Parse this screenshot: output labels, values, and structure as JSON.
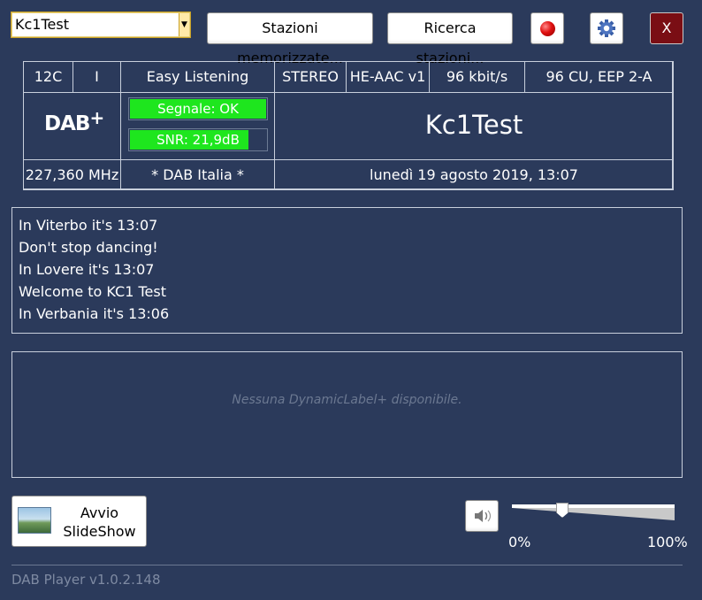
{
  "toolbar": {
    "station_selected": "Kc1Test",
    "saved_stations_label": "Stazioni memorizzate...",
    "search_stations_label": "Ricerca stazioni...",
    "close_label": "X",
    "record_icon": "record-icon",
    "settings_icon": "gear-icon"
  },
  "info": {
    "channel": "12C",
    "language": "I",
    "genre": "Easy Listening",
    "audio_mode": "STEREO",
    "codec": "HE-AAC v1",
    "bitrate": "96 kbit/s",
    "protection": "96 CU, EEP 2-A",
    "logo_text": "DAB",
    "logo_plus": "+",
    "signal_label": "Segnale: OK",
    "signal_level": 1.0,
    "snr_label": "SNR: 21,9dB",
    "snr_level": 0.87,
    "station_name": "Kc1Test",
    "frequency": "227,360 MHz",
    "ensemble": "* DAB Italia *",
    "datetime": "lunedì 19 agosto 2019, 13:07"
  },
  "rds": {
    "lines": [
      "In Viterbo it's 13:07",
      "Don't stop dancing!",
      "In Lovere it's 13:07",
      "Welcome to KC1 Test",
      "In Verbania it's 13:06"
    ]
  },
  "dynamic_label": {
    "empty_text": "Nessuna DynamicLabel+ disponibile."
  },
  "bottom": {
    "slideshow_label_line1": "Avvio",
    "slideshow_label_line2": "SlideShow",
    "volume_min_label": "0%",
    "volume_max_label": "100%",
    "volume_level": 0.31,
    "version": "DAB Player v1.0.2.148"
  },
  "colors": {
    "background": "#2b3a5b",
    "signal_green": "#1ee61e",
    "close_red": "#7a0e14"
  }
}
